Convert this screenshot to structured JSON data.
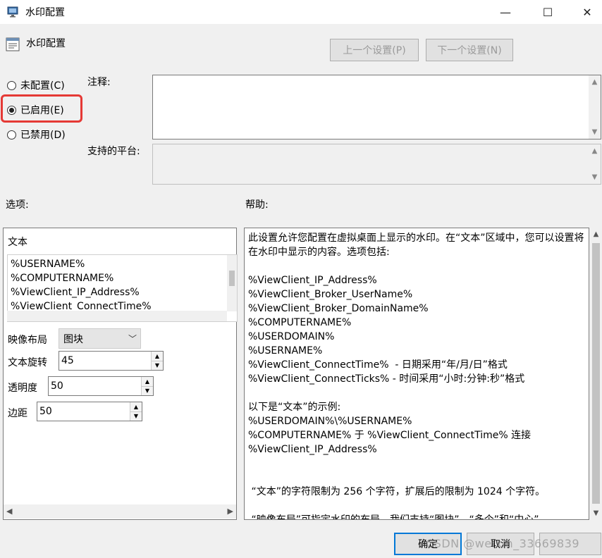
{
  "window": {
    "title": "水印配置",
    "minimize": "—",
    "maximize": "☐",
    "close": "✕"
  },
  "header": {
    "title": "水印配置"
  },
  "nav": {
    "prev_label": "上一个设置(P)",
    "next_label": "下一个设置(N)"
  },
  "state": {
    "options": [
      {
        "label": "未配置(C)",
        "checked": false
      },
      {
        "label": "已启用(E)",
        "checked": true
      },
      {
        "label": "已禁用(D)",
        "checked": false
      }
    ]
  },
  "comment": {
    "label": "注释:",
    "value": ""
  },
  "platform": {
    "label": "支持的平台:",
    "value": ""
  },
  "options_panel": {
    "section_label": "选项:",
    "text_label": "文本",
    "text_items": [
      "%USERNAME%",
      "%COMPUTERNAME%",
      "%ViewClient_IP_Address%",
      "%ViewClient_ConnectTime%"
    ],
    "layout_label": "映像布局",
    "layout_value": "图块",
    "rotation_label": "文本旋转",
    "rotation_value": "45",
    "opacity_label": "透明度",
    "opacity_value": "50",
    "margin_label": "边距",
    "margin_value": "50"
  },
  "help": {
    "section_label": "帮助:",
    "text": "此设置允许您配置在虚拟桌面上显示的水印。在“文本”区域中，您可以设置将在水印中显示的内容。选项包括:\n\n%ViewClient_IP_Address%\n%ViewClient_Broker_UserName%\n%ViewClient_Broker_DomainName%\n%COMPUTERNAME%\n%USERDOMAIN%\n%USERNAME%\n%ViewClient_ConnectTime%  - 日期采用“年/月/日”格式\n%ViewClient_ConnectTicks% - 时间采用“小时:分钟:秒”格式\n\n以下是“文本”的示例:\n%USERDOMAIN%\\%USERNAME%\n%COMPUTERNAME% 于 %ViewClient_ConnectTime% 连接\n%ViewClient_IP_Address%\n\n\n “文本”的字符限制为 256 个字符，扩展后的限制为 1024 个字符。\n\n “映像布局”可指定水印的布局。我们支持“图块”、“多个”和“中心”"
  },
  "footer": {
    "ok_label": "确定",
    "cancel_label": "取消",
    "apply_label": "",
    "watermark": "CSDN @weixin_33669839"
  },
  "colors": {
    "highlight": "#e53935",
    "focus": "#0078d7"
  }
}
